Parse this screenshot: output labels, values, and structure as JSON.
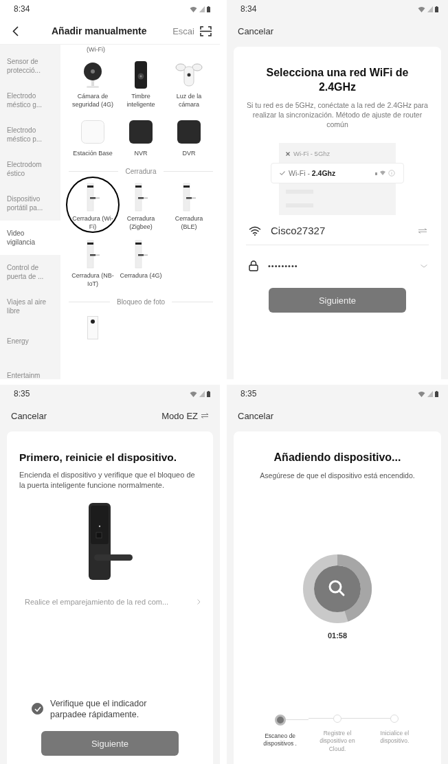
{
  "add_manually": {
    "status_bar": {
      "time": "8:34"
    },
    "title": "Añadir manualmente",
    "scan_label": "Escai",
    "sidebar": [
      {
        "label": "Sensor de protecció...",
        "selected": false
      },
      {
        "label": "Electrodo méstico g...",
        "selected": false
      },
      {
        "label": "Electrodo méstico p...",
        "selected": false
      },
      {
        "label": "Electrodom éstico",
        "selected": false
      },
      {
        "label": "Dispositivo portátil pa...",
        "selected": false
      },
      {
        "label": "Video vigilancia",
        "selected": true
      },
      {
        "label": "Control de puerta de ...",
        "selected": false
      },
      {
        "label": "Viajes al aire libre",
        "selected": false
      },
      {
        "label": "Energy",
        "selected": false
      },
      {
        "label": "Entertainm",
        "selected": false
      }
    ],
    "content": [
      {
        "kind": "label",
        "text": "(Wi-Fi)"
      },
      {
        "kind": "grid",
        "items": [
          {
            "kind": "camera",
            "label": "Cámara de seguridad (4G)",
            "highlighted": false
          },
          {
            "kind": "doorbell",
            "label": "Timbre inteligente",
            "highlighted": false
          },
          {
            "kind": "floodlight",
            "label": "Luz de la cámara",
            "highlighted": false
          },
          {
            "kind": "hub",
            "label": "Estación Base",
            "highlighted": false
          },
          {
            "kind": "recorder",
            "label": "NVR",
            "highlighted": false
          },
          {
            "kind": "recorder",
            "label": "DVR",
            "highlighted": false
          }
        ]
      },
      {
        "kind": "heading",
        "text": "Cerradura"
      },
      {
        "kind": "grid",
        "items": [
          {
            "kind": "lock",
            "label": "Cerradura (Wi-Fi)",
            "highlighted": true
          },
          {
            "kind": "lock",
            "label": "Cerradura (Zigbee)",
            "highlighted": false
          },
          {
            "kind": "lock",
            "label": "Cerradura (BLE)",
            "highlighted": false
          },
          {
            "kind": "lock",
            "label": "Cerradura (NB-IoT)",
            "highlighted": false
          },
          {
            "kind": "lock",
            "label": "Cerradura (4G)",
            "highlighted": false
          }
        ]
      },
      {
        "kind": "heading",
        "text": "Bloqueo de foto"
      },
      {
        "kind": "grid",
        "items": [
          {
            "kind": "photo_lock",
            "highlighted": false
          }
        ]
      }
    ]
  },
  "wifi": {
    "status_bar": {
      "time": "8:34"
    },
    "cancel": "Cancelar",
    "title": "Selecciona una red WiFi de 2.4GHz",
    "description": "Si tu red es de 5GHz, conéctate a la red de 2.4GHz para realizar la sincronización. Método de ajuste de router común",
    "networks": [
      {
        "label": "Wi-Fi - 5Ghz",
        "selected": false
      },
      {
        "label": "Wi-Fi - **2.4Ghz**",
        "selected": true
      }
    ],
    "ssid": "Cisco27327",
    "password": "•••••••••",
    "button": "Siguiente"
  },
  "reset": {
    "status_bar": {
      "time": "8:35"
    },
    "cancel": "Cancelar",
    "mode": "Modo EZ",
    "title": "Primero, reinicie el dispositivo.",
    "description": "Encienda el dispositivo y verifique que el bloqueo de la puerta inteligente funcione normalmente.",
    "link": "Realice el emparejamiento de la red com...",
    "confirm": {
      "label": "Verifique que el indicador parpadee rápidamente.",
      "checked": true
    },
    "button": "Siguiente"
  },
  "adding": {
    "status_bar": {
      "time": "8:35"
    },
    "cancel": "Cancelar",
    "title": "Añadiendo dispositivo...",
    "description": "Asegúrese de que el dispositivo está encendido.",
    "timer": "01:58",
    "steps": [
      {
        "label": "Escaneo de dispositivos .",
        "active": true
      },
      {
        "label": "Registre el dispositivo en Cloud.",
        "active": false
      },
      {
        "label": "Inicialice el dispositivo.",
        "active": false
      }
    ]
  }
}
